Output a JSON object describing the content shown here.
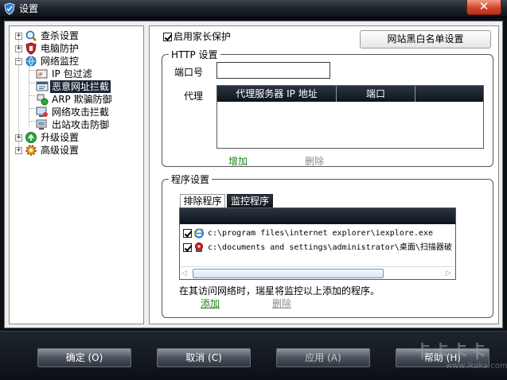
{
  "window": {
    "title": "设置",
    "close_glyph": "✕"
  },
  "tree": {
    "items": [
      {
        "label": "查杀设置",
        "icon": "scan-icon"
      },
      {
        "label": "电脑防护",
        "icon": "shield-icon"
      },
      {
        "label": "网络监控",
        "icon": "network-globe-icon"
      },
      {
        "label": "IP 包过滤",
        "icon": "ip-filter-icon"
      },
      {
        "label": "恶意网址拦截",
        "icon": "url-block-icon"
      },
      {
        "label": "ARP 欺骗防御",
        "icon": "arp-icon"
      },
      {
        "label": "网络攻击拦截",
        "icon": "attack-block-icon"
      },
      {
        "label": "出站攻击防御",
        "icon": "outbound-icon"
      },
      {
        "label": "升级设置",
        "icon": "upgrade-icon"
      },
      {
        "label": "高级设置",
        "icon": "advanced-gear-icon"
      }
    ],
    "expand_glyphs": [
      "+",
      "+",
      "−",
      "+",
      "+"
    ]
  },
  "panel": {
    "parental_control_label": "启用家长保护",
    "blacklist_button": "网站黑白名单设置",
    "http": {
      "legend": "HTTP 设置",
      "port_label": "端口号",
      "port_value": "",
      "proxy_label": "代理",
      "columns": [
        "代理服务器 IP 地址",
        "端口"
      ],
      "add_label": "增加",
      "delete_label": "删除"
    },
    "programs": {
      "legend": "程序设置",
      "tabs": [
        "排除程序",
        "监控程序"
      ],
      "rows": [
        {
          "path": "c:\\program files\\internet explorer\\iexplore.exe",
          "icon": "ie-icon"
        },
        {
          "path": "c:\\documents and settings\\administrator\\桌面\\扫描器破",
          "icon": "scanner-app-icon"
        }
      ],
      "scroll_left": "◁",
      "scroll_right": "▷",
      "note": "在其访问网络时，瑞星将监控以上添加的程序。",
      "add_label": "添加",
      "delete_label": "删除"
    }
  },
  "footer": {
    "ok_label": "确定 (O)",
    "cancel_label": "取消 (C)",
    "apply_label": "应用 (A)",
    "help_label": "帮助 (H)"
  },
  "watermark": {
    "text": "卡卡卡卡",
    "url": "www.ikaka.com"
  }
}
